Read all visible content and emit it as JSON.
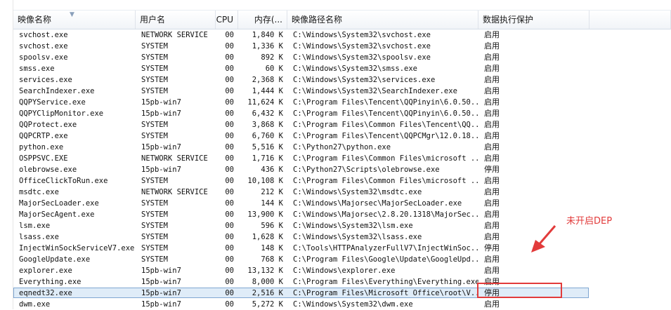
{
  "columns": [
    {
      "label": "映像名称"
    },
    {
      "label": "用户名"
    },
    {
      "label": "CPU"
    },
    {
      "label": "内存(..."
    },
    {
      "label": "映像路径名称"
    },
    {
      "label": "数据执行保护"
    },
    {
      "label": ""
    }
  ],
  "rows": [
    [
      "svchost.exe",
      "NETWORK SERVICE",
      "00",
      "1,840 K",
      "C:\\Windows\\System32\\svchost.exe",
      "启用"
    ],
    [
      "svchost.exe",
      "SYSTEM",
      "00",
      "1,336 K",
      "C:\\Windows\\System32\\svchost.exe",
      "启用"
    ],
    [
      "spoolsv.exe",
      "SYSTEM",
      "00",
      "892 K",
      "C:\\Windows\\System32\\spoolsv.exe",
      "启用"
    ],
    [
      "smss.exe",
      "SYSTEM",
      "00",
      "60 K",
      "C:\\Windows\\System32\\smss.exe",
      "启用"
    ],
    [
      "services.exe",
      "SYSTEM",
      "00",
      "2,368 K",
      "C:\\Windows\\System32\\services.exe",
      "启用"
    ],
    [
      "SearchIndexer.exe",
      "SYSTEM",
      "00",
      "1,444 K",
      "C:\\Windows\\System32\\SearchIndexer.exe",
      "启用"
    ],
    [
      "QQPYService.exe",
      "15pb-win7",
      "00",
      "11,624 K",
      "C:\\Program Files\\Tencent\\QQPinyin\\6.0.50...",
      "启用"
    ],
    [
      "QQPYClipMonitor.exe",
      "15pb-win7",
      "00",
      "6,432 K",
      "C:\\Program Files\\Tencent\\QQPinyin\\6.0.50...",
      "启用"
    ],
    [
      "QQProtect.exe",
      "SYSTEM",
      "00",
      "3,868 K",
      "C:\\Program Files\\Common Files\\Tencent\\QQ...",
      "启用"
    ],
    [
      "QQPCRTP.exe",
      "SYSTEM",
      "00",
      "6,760 K",
      "C:\\Program Files\\Tencent\\QQPCMgr\\12.0.18...",
      "启用"
    ],
    [
      "python.exe",
      "15pb-win7",
      "00",
      "5,516 K",
      "C:\\Python27\\python.exe",
      "启用"
    ],
    [
      "OSPPSVC.EXE",
      "NETWORK SERVICE",
      "00",
      "1,716 K",
      "C:\\Program Files\\Common Files\\microsoft ...",
      "启用"
    ],
    [
      "olebrowse.exe",
      "15pb-win7",
      "00",
      "436 K",
      "C:\\Python27\\Scripts\\olebrowse.exe",
      "停用"
    ],
    [
      "OfficeClickToRun.exe",
      "SYSTEM",
      "00",
      "10,108 K",
      "C:\\Program Files\\Common Files\\microsoft ...",
      "启用"
    ],
    [
      "msdtc.exe",
      "NETWORK SERVICE",
      "00",
      "212 K",
      "C:\\Windows\\System32\\msdtc.exe",
      "启用"
    ],
    [
      "MajorSecLoader.exe",
      "SYSTEM",
      "00",
      "144 K",
      "C:\\Windows\\Majorsec\\MajorSecLoader.exe",
      "启用"
    ],
    [
      "MajorSecAgent.exe",
      "SYSTEM",
      "00",
      "13,900 K",
      "C:\\Windows\\Majorsec\\2.8.20.1318\\MajorSec...",
      "启用"
    ],
    [
      "lsm.exe",
      "SYSTEM",
      "00",
      "596 K",
      "C:\\Windows\\System32\\lsm.exe",
      "启用"
    ],
    [
      "lsass.exe",
      "SYSTEM",
      "00",
      "1,628 K",
      "C:\\Windows\\System32\\lsass.exe",
      "启用"
    ],
    [
      "InjectWinSockServiceV7.exe",
      "SYSTEM",
      "00",
      "148 K",
      "C:\\Tools\\HTTPAnalyzerFullV7\\InjectWinSoc...",
      "停用"
    ],
    [
      "GoogleUpdate.exe",
      "SYSTEM",
      "00",
      "768 K",
      "C:\\Program Files\\Google\\Update\\GoogleUpd...",
      "启用"
    ],
    [
      "explorer.exe",
      "15pb-win7",
      "00",
      "13,132 K",
      "C:\\Windows\\explorer.exe",
      "启用"
    ],
    [
      "Everything.exe",
      "15pb-win7",
      "00",
      "8,000 K",
      "C:\\Program Files\\Everything\\Everything.exe",
      "启用"
    ],
    [
      "eqnedt32.exe",
      "15pb-win7",
      "00",
      "2,516 K",
      "C:\\Program Files\\Microsoft Office\\root\\V...",
      "停用"
    ],
    [
      "dwm.exe",
      "15pb-win7",
      "00",
      "5,272 K",
      "C:\\Windows\\System32\\dwm.exe",
      "启用"
    ]
  ],
  "selected_row_index": 23,
  "annotation": {
    "text": "未开启DEP",
    "color": "#e23b3b"
  }
}
